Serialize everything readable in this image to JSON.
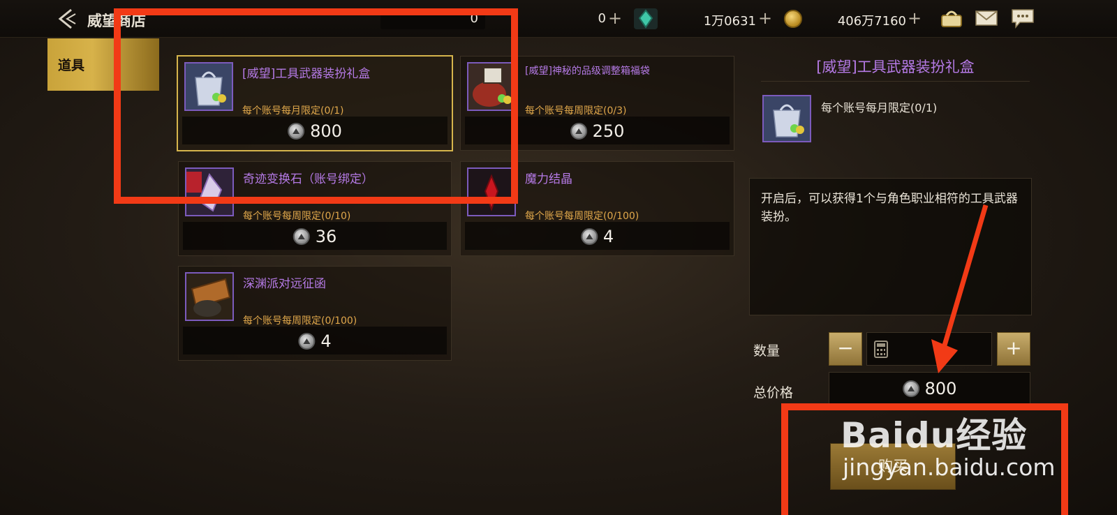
{
  "header": {
    "title": "威望商店",
    "currency_slot1_value": "0",
    "currency_slot2_value": "0",
    "gem_value": "1万0631",
    "gold_value": "406万7160",
    "plus_label": "+"
  },
  "sidebar": {
    "items": [
      {
        "label": "道具",
        "active": true
      }
    ]
  },
  "items": [
    {
      "name": "[威望]工具武器装扮礼盒",
      "limit": "每个账号每月限定(0/1)",
      "price": "800",
      "selected": true
    },
    {
      "name": "[威望]神秘的品级调整箱福袋",
      "limit": "每个账号每周限定(0/3)",
      "price": "250",
      "selected": false
    },
    {
      "name": "奇迹变换石（账号绑定）",
      "limit": "每个账号每周限定(0/10)",
      "price": "36",
      "selected": false,
      "icon_tag": "账号"
    },
    {
      "name": "魔力结晶",
      "limit": "每个账号每周限定(0/100)",
      "price": "4",
      "selected": false
    },
    {
      "name": "深渊派对远征函",
      "limit": "每个账号每周限定(0/100)",
      "price": "4",
      "selected": false
    }
  ],
  "detail": {
    "title": "[威望]工具武器装扮礼盒",
    "limit": "每个账号每月限定(0/1)",
    "description": "开启后，可以获得1个与角色职业相符的工具武器装扮。",
    "quantity_label": "数量",
    "minus_label": "−",
    "plus_label": "+",
    "total_label": "总价格",
    "total_value": "800",
    "buy_label": "购买"
  },
  "watermark": {
    "logo": "Baidu经验",
    "url": "jingyan.baidu.com"
  },
  "colors": {
    "annotation": "#f23a16",
    "item_name": "#b57ae6",
    "limit_text": "#e1a84b",
    "tab_gold": "#d7b24a"
  },
  "icons": [
    "back-arrow-icon",
    "gem-icon",
    "gold-coin-icon",
    "bag-icon",
    "mail-icon",
    "chat-icon",
    "reputation-coin-icon",
    "calculator-icon"
  ]
}
